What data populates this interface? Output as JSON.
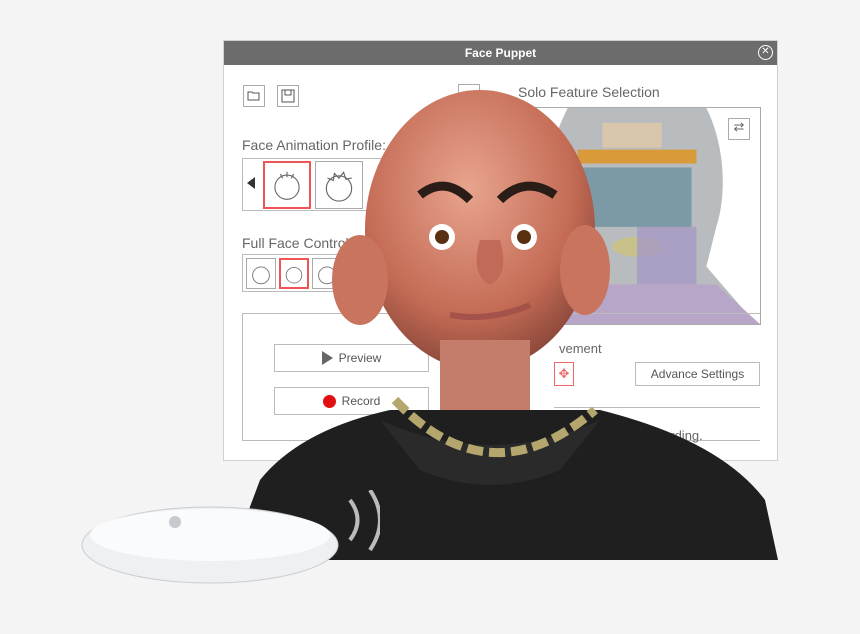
{
  "window": {
    "title": "Face Puppet",
    "close_icon": "close-circle-icon"
  },
  "toolbar": {
    "open_icon": "folder-open-icon",
    "save_icon": "save-disk-icon",
    "help_label": "?"
  },
  "profile": {
    "label": "Face Animation Profile:",
    "prev_icon": "triangle-left-icon"
  },
  "full_face": {
    "label": "Full Face Control:"
  },
  "solo": {
    "title": "Solo Feature Selection",
    "swap_icon": "swap-arrows-icon"
  },
  "movement": {
    "label_fragment": "vement",
    "move_icon": "move-arrows-icon"
  },
  "buttons": {
    "preview": "Preview",
    "record": "Record",
    "advance": "Advance Settings"
  },
  "hint_fragment": "ext recording.",
  "colors": {
    "title_bar": "#6d6c6c",
    "selection": "#e55555",
    "record": "#e01010"
  }
}
